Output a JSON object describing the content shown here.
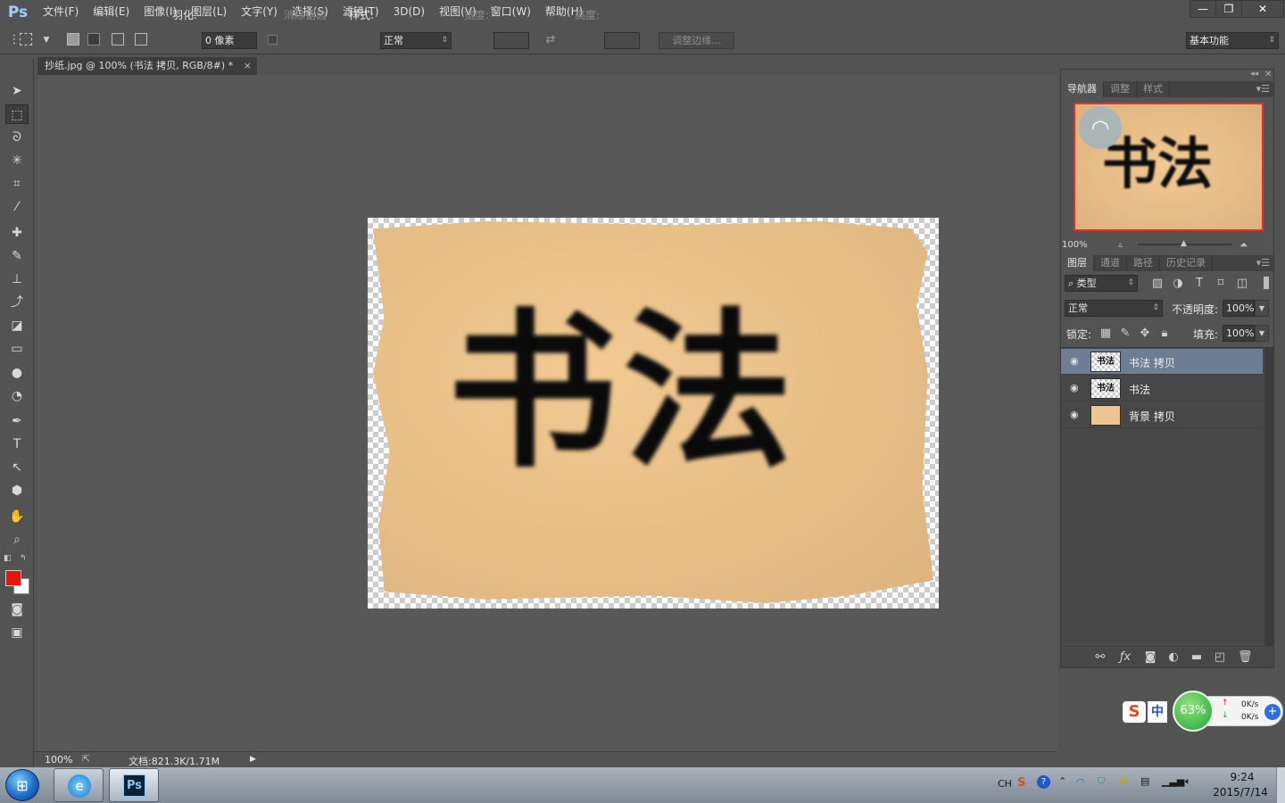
{
  "app": {
    "logo": "Ps"
  },
  "menu": [
    "文件(F)",
    "编辑(E)",
    "图像(I)",
    "图层(L)",
    "文字(Y)",
    "选择(S)",
    "滤镜(T)",
    "3D(D)",
    "视图(V)",
    "窗口(W)",
    "帮助(H)"
  ],
  "window_controls": {
    "minimize": "—",
    "restore": "❐",
    "close": "✕"
  },
  "options": {
    "feather_label": "羽化:",
    "feather_value": "0 像素",
    "antialias_label": "消除锯齿",
    "style_label": "样式:",
    "style_value": "正常",
    "width_label": "宽度:",
    "height_label": "高度:",
    "refine_edge": "调整边缘...",
    "workspace": "基本功能"
  },
  "document": {
    "tab_title": "抄纸.jpg @ 100% (书法 拷贝, RGB/8#) *",
    "tab_close": "×",
    "calligraphy": "书法"
  },
  "status": {
    "zoom": "100%",
    "doc_info": "文档:821.3K/1.71M",
    "arrow": "▶"
  },
  "navigator": {
    "tabs": [
      "导航器",
      "调整",
      "样式"
    ],
    "zoom": "100%"
  },
  "layers_panel": {
    "tabs": [
      "图层",
      "通道",
      "路径",
      "历史记录"
    ],
    "filter_kind": "类型",
    "blend_mode": "正常",
    "opacity_label": "不透明度:",
    "opacity_value": "100%",
    "lock_label": "锁定:",
    "fill_label": "填充:",
    "fill_value": "100%",
    "layers": [
      {
        "name": "书法 拷贝",
        "thumb_text": "书法",
        "selected": true
      },
      {
        "name": "书法",
        "thumb_text": "书法",
        "selected": false
      },
      {
        "name": "背景 拷贝",
        "thumb_text": "",
        "selected": false
      }
    ]
  },
  "net_widget": {
    "percent": "63%",
    "up": "0K/s",
    "down": "0K/s",
    "ime_logo": "S",
    "ime_mode": "中"
  },
  "taskbar": {
    "tray_lang": "CH",
    "time": "9:24",
    "date": "2015/7/14",
    "ps_label": "Ps"
  },
  "colors": {
    "foreground": "#e8140c",
    "background": "#ffffff",
    "selected_layer": "#6d7d94"
  }
}
